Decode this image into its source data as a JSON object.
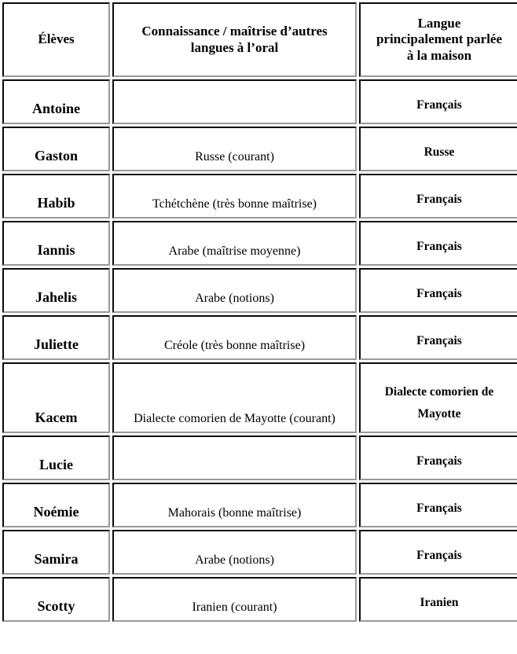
{
  "document": {
    "type": "table",
    "language": "fr",
    "columns": [
      {
        "key": "eleves",
        "header": "Élèves",
        "header_lines": [
          "Élèves"
        ],
        "bold": true,
        "align": "center"
      },
      {
        "key": "connaissance",
        "header": "Connaissance / maîtrise d’autres langues à l’oral",
        "header_lines": [
          "Connaissance / maîtrise d’autres",
          "langues à l’oral"
        ],
        "bold": false,
        "align": "center"
      },
      {
        "key": "langue_maison",
        "header": "Langue principalement parlée à la maison",
        "header_lines": [
          "Langue",
          "principalement parlée",
          "à la maison"
        ],
        "bold": true,
        "align": "center"
      }
    ],
    "rows": [
      {
        "eleve": "Antoine",
        "autres_langues": "",
        "langue_maison": "Français",
        "langue_maison_lines": [
          "Français"
        ]
      },
      {
        "eleve": "Gaston",
        "autres_langues": "Russe (courant)",
        "langue_maison": "Russe",
        "langue_maison_lines": [
          "Russe"
        ]
      },
      {
        "eleve": "Habib",
        "autres_langues": "Tchétchène (très bonne maîtrise)",
        "langue_maison": "Français",
        "langue_maison_lines": [
          "Français"
        ]
      },
      {
        "eleve": "Iannis",
        "autres_langues": "Arabe (maîtrise moyenne)",
        "langue_maison": "Français",
        "langue_maison_lines": [
          "Français"
        ]
      },
      {
        "eleve": "Jahelis",
        "autres_langues": "Arabe (notions)",
        "langue_maison": "Français",
        "langue_maison_lines": [
          "Français"
        ]
      },
      {
        "eleve": "Juliette",
        "autres_langues": "Créole (très bonne maîtrise)",
        "langue_maison": "Français",
        "langue_maison_lines": [
          "Français"
        ]
      },
      {
        "eleve": "Kacem",
        "autres_langues": "Dialecte comorien de Mayotte (courant)",
        "langue_maison": "Dialecte comorien de Mayotte",
        "langue_maison_lines": [
          "Dialecte comorien de",
          "Mayotte"
        ]
      },
      {
        "eleve": "Lucie",
        "autres_langues": "",
        "langue_maison": "Français",
        "langue_maison_lines": [
          "Français"
        ]
      },
      {
        "eleve": "Noémie",
        "autres_langues": "Mahorais (bonne maîtrise)",
        "langue_maison": "Français",
        "langue_maison_lines": [
          "Français"
        ]
      },
      {
        "eleve": "Samira",
        "autres_langues": "Arabe (notions)",
        "langue_maison": "Français",
        "langue_maison_lines": [
          "Français"
        ]
      },
      {
        "eleve": "Scotty",
        "autres_langues": "Iranien (courant)",
        "langue_maison": "Iranien",
        "langue_maison_lines": [
          "Iranien"
        ]
      }
    ],
    "colors": {
      "text": "#000000",
      "page_background": "#ffffff",
      "cell_background": "#ffffff",
      "border_dark": "#0a0a0a",
      "border_light": "#9a9a9a"
    }
  }
}
